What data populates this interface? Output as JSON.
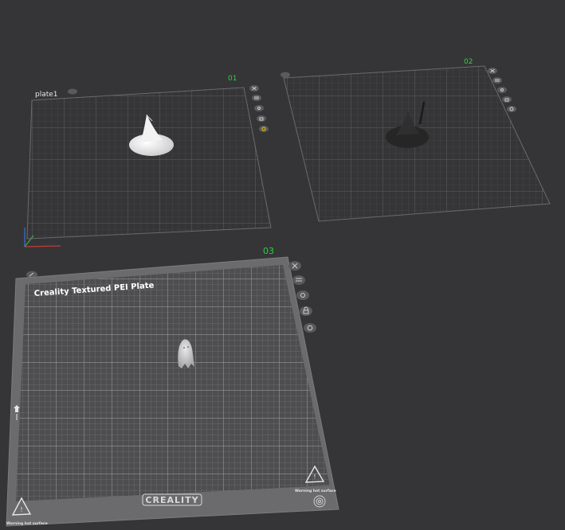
{
  "plates": [
    {
      "index": "01",
      "name": "plate1",
      "model": "white-hat"
    },
    {
      "index": "02",
      "name": "",
      "model": "black-hat"
    },
    {
      "index": "03",
      "name": "",
      "model": "ghost"
    }
  ],
  "bed": {
    "title": "Creality Textured PEI Plate",
    "brand": "CREALITY",
    "warning": "Warning hot surface"
  },
  "plate_tool_icons": [
    "close-icon",
    "arrange-icon",
    "orient-icon",
    "lock-icon",
    "settings-icon"
  ],
  "colors": {
    "background": "#353537",
    "plate_number": "#2ad33a",
    "grid_line": "#5c5c5f",
    "bed_surface": "#4e4e50",
    "bed_frame": "#6b6b6d",
    "selected_icon": "#d8b400"
  }
}
